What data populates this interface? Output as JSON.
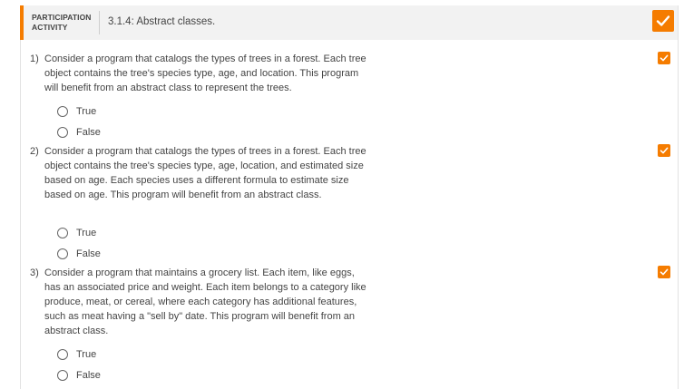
{
  "activity": {
    "label": "PARTICIPATION\nACTIVITY",
    "title": "3.1.4: Abstract classes.",
    "status_icon": "check-icon",
    "accent_color": "#f57c00"
  },
  "questions": [
    {
      "number": "1)",
      "text": "Consider a program that catalogs the types of trees in a forest. Each tree object contains the tree's species type, age, and location. This program will benefit from an abstract class to represent the trees.",
      "completed_icon": "check-icon",
      "options": [
        "True",
        "False"
      ]
    },
    {
      "number": "2)",
      "text": "Consider a program that catalogs the types of trees in a forest. Each tree object contains the tree's species type, age, location, and estimated size based on age. Each species uses a different formula to estimate size based on age. This program will benefit from an abstract class.",
      "completed_icon": "check-icon",
      "options": [
        "True",
        "False"
      ]
    },
    {
      "number": "3)",
      "text": "Consider a program that maintains a grocery list. Each item, like eggs, has an associated price and weight. Each item belongs to a category like produce, meat, or cereal, where each category has additional features, such as meat having a \"sell by\" date. This program will benefit from an abstract class.",
      "completed_icon": "check-icon",
      "options": [
        "True",
        "False"
      ]
    }
  ]
}
